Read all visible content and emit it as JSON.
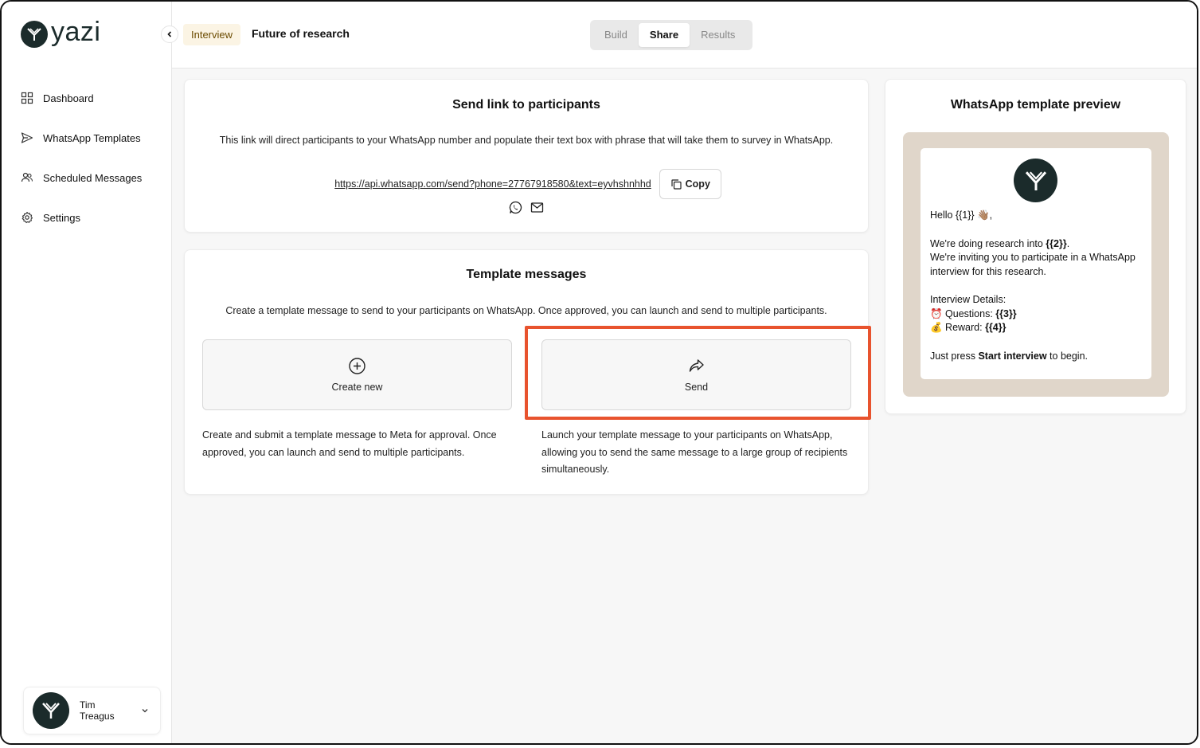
{
  "app": {
    "logo_text": "yazi"
  },
  "sidebar": {
    "items": [
      {
        "label": "Dashboard",
        "icon": "grid-icon"
      },
      {
        "label": "WhatsApp Templates",
        "icon": "send-icon"
      },
      {
        "label": "Scheduled Messages",
        "icon": "users-icon"
      },
      {
        "label": "Settings",
        "icon": "gear-icon"
      }
    ],
    "user": {
      "name": "Tim Treagus"
    }
  },
  "header": {
    "badge": "Interview",
    "title": "Future of research",
    "tabs": [
      {
        "label": "Build",
        "active": false
      },
      {
        "label": "Share",
        "active": true
      },
      {
        "label": "Results",
        "active": false
      }
    ]
  },
  "send_link": {
    "title": "Send link to participants",
    "description": "This link will direct participants to your WhatsApp number and populate their text box with phrase that will take them to survey in WhatsApp.",
    "url": "https://api.whatsapp.com/send?phone=27767918580&text=eyvhshnhhd",
    "copy_label": "Copy"
  },
  "templates": {
    "title": "Template messages",
    "description": "Create a template message to send to your participants on WhatsApp. Once approved, you can launch and send to multiple participants.",
    "create": {
      "label": "Create new",
      "description": "Create and submit a template message to Meta for approval. Once approved, you can launch and send to multiple participants."
    },
    "send": {
      "label": "Send",
      "description": "Launch your template message to your participants on WhatsApp, allowing you to send the same message to a large group of recipients simultaneously."
    }
  },
  "preview": {
    "title": "WhatsApp template preview",
    "greeting": "Hello {{1}} 👋🏽,",
    "line1_prefix": "We're doing research into ",
    "line1_var": "{{2}}",
    "line1_suffix": ".",
    "line2": "We're inviting you to participate in a WhatsApp interview for this research.",
    "details_heading": "Interview Details:",
    "questions_prefix": "⏰ Questions: ",
    "questions_var": "{{3}}",
    "reward_prefix": "💰 Reward: ",
    "reward_var": "{{4}}",
    "cta_prefix": "Just press ",
    "cta_bold": "Start interview",
    "cta_suffix": " to begin."
  },
  "colors": {
    "brand": "#1b2b2b",
    "highlight": "#e8532e",
    "badge_bg": "#fbf4e4"
  }
}
